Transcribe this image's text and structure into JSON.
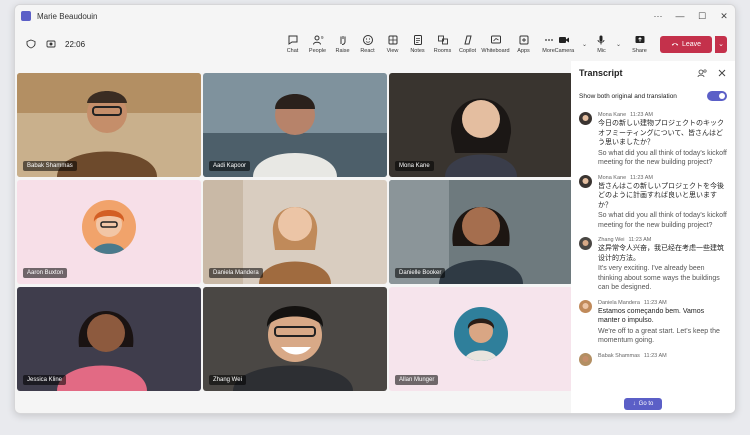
{
  "window": {
    "title": "Marie Beaudouin"
  },
  "toolbar": {
    "timer": "22:06",
    "tools": [
      {
        "label": "Chat",
        "icon": "chat-icon"
      },
      {
        "label": "People",
        "icon": "people-icon",
        "count": "9"
      },
      {
        "label": "Raise",
        "icon": "raise-hand-icon"
      },
      {
        "label": "React",
        "icon": "react-icon"
      },
      {
        "label": "View",
        "icon": "view-icon"
      },
      {
        "label": "Notes",
        "icon": "notes-icon"
      },
      {
        "label": "Rooms",
        "icon": "rooms-icon"
      },
      {
        "label": "Copilot",
        "icon": "copilot-icon"
      },
      {
        "label": "Whiteboard",
        "icon": "whiteboard-icon"
      },
      {
        "label": "Apps",
        "icon": "apps-icon"
      },
      {
        "label": "More",
        "icon": "more-icon"
      }
    ],
    "camera_label": "Camera",
    "mic_label": "Mic",
    "share_label": "Share",
    "leave_label": "Leave",
    "leave_color": "#c4314b"
  },
  "participants": [
    {
      "name": "Babak Shammas",
      "type": "video",
      "bg": "#b08a5c"
    },
    {
      "name": "Aadi Kapoor",
      "type": "video",
      "bg": "#6a7f8e"
    },
    {
      "name": "Mona Kane",
      "type": "video",
      "bg": "#2e2a28"
    },
    {
      "name": "Aaron Buxton",
      "type": "avatar",
      "bg": "#f7dfe8"
    },
    {
      "name": "Daniela Mandera",
      "type": "video",
      "bg": "#d8cabc"
    },
    {
      "name": "Danielle Booker",
      "type": "video",
      "bg": "#5f6b70"
    },
    {
      "name": "Jessica Kline",
      "type": "video",
      "bg": "#d56a7e"
    },
    {
      "name": "Zhang Wei",
      "type": "video",
      "bg": "#3b3a38"
    },
    {
      "name": "Allan Munger",
      "type": "avatar",
      "bg": "#f6e4ec"
    }
  ],
  "transcript": {
    "title": "Transcript",
    "toggle_label": "Show both original and translation",
    "accent": "#5b5fc7",
    "entries": [
      {
        "speaker": "Mona Kane",
        "time": "11:23 AM",
        "original": "今日の新しい建物プロジェクトのキックオフミーティングについて、皆さんはどう思いましたか？",
        "translation": "So what did you all think of today's kickoff meeting for the new building project?"
      },
      {
        "speaker": "Mona Kane",
        "time": "11:23 AM",
        "original": "皆さんはこの新しいプロジェクトを今後どのように計画すれば良いと思いますか？",
        "translation": "So what did you all think of today's kickoff meeting for the new building project?"
      },
      {
        "speaker": "Zhang Wei",
        "time": "11:23 AM",
        "original": "这异常令人兴奋，我已经在考虑一些建筑设计的方法。",
        "translation": "It's very exciting. I've already been thinking about some ways the buildings can be designed."
      },
      {
        "speaker": "Daniela Mandera",
        "time": "11:23 AM",
        "original": "Estamos começando bem. Vamos manter o impulso.",
        "translation": "We're off to a great start. Let's keep the momentum going."
      },
      {
        "speaker": "Babak Shammas",
        "time": "11:23 AM"
      }
    ],
    "goto_label": "Go to"
  }
}
